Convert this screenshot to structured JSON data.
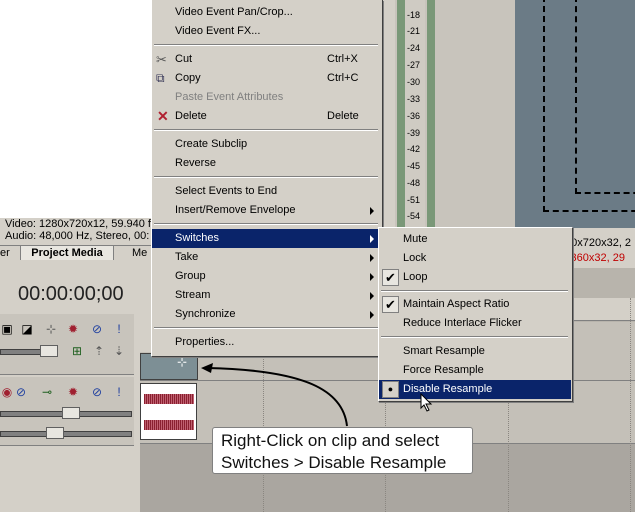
{
  "media_info": {
    "line1": "Video: 1280x720x12, 59.940 f",
    "line2": "Audio: 48,000 Hz, Stereo, 00:"
  },
  "tabs": {
    "left_partial": "er",
    "project_media": "Project Media",
    "right_partial": "Me"
  },
  "timecode": "00:00:00;00",
  "meter_scale": [
    "-18",
    "-21",
    "-24",
    "-27",
    "-30",
    "-33",
    "-36",
    "-39",
    "-42",
    "-45",
    "-48",
    "-51",
    "-54"
  ],
  "preview_info": {
    "line1": "80x720x32, 2",
    "line2": "x360x32, 29"
  },
  "context_menu": {
    "items": [
      {
        "id": "pan-crop",
        "label": "Video Event Pan/Crop...",
        "shortcut": ""
      },
      {
        "id": "event-fx",
        "label": "Video Event FX...",
        "shortcut": ""
      },
      {
        "id": "cut",
        "label": "Cut",
        "shortcut": "Ctrl+X"
      },
      {
        "id": "copy",
        "label": "Copy",
        "shortcut": "Ctrl+C"
      },
      {
        "id": "paste-attrs",
        "label": "Paste Event Attributes",
        "shortcut": ""
      },
      {
        "id": "delete",
        "label": "Delete",
        "shortcut": "Delete"
      },
      {
        "id": "create-subclip",
        "label": "Create Subclip",
        "shortcut": ""
      },
      {
        "id": "reverse",
        "label": "Reverse",
        "shortcut": ""
      },
      {
        "id": "select-to-end",
        "label": "Select Events to End",
        "shortcut": ""
      },
      {
        "id": "insert-envelope",
        "label": "Insert/Remove Envelope",
        "shortcut": ""
      },
      {
        "id": "switches",
        "label": "Switches",
        "shortcut": ""
      },
      {
        "id": "take",
        "label": "Take",
        "shortcut": ""
      },
      {
        "id": "group",
        "label": "Group",
        "shortcut": ""
      },
      {
        "id": "stream",
        "label": "Stream",
        "shortcut": ""
      },
      {
        "id": "synchronize",
        "label": "Synchronize",
        "shortcut": ""
      },
      {
        "id": "properties",
        "label": "Properties...",
        "shortcut": ""
      }
    ]
  },
  "switches_menu": {
    "items": [
      {
        "id": "mute",
        "label": "Mute"
      },
      {
        "id": "lock",
        "label": "Lock"
      },
      {
        "id": "loop",
        "label": "Loop"
      },
      {
        "id": "maintain-aspect",
        "label": "Maintain Aspect Ratio"
      },
      {
        "id": "reduce-flicker",
        "label": "Reduce Interlace Flicker"
      },
      {
        "id": "smart-resample",
        "label": "Smart Resample"
      },
      {
        "id": "force-resample",
        "label": "Force Resample"
      },
      {
        "id": "disable-resample",
        "label": "Disable Resample"
      }
    ]
  },
  "callout": {
    "line1": "Right-Click on clip and select",
    "line2": "Switches > Disable Resample"
  },
  "colors": {
    "highlight": "#0a246a",
    "menu_bg": "#d4d0c8",
    "waveform": "#8a2030"
  }
}
